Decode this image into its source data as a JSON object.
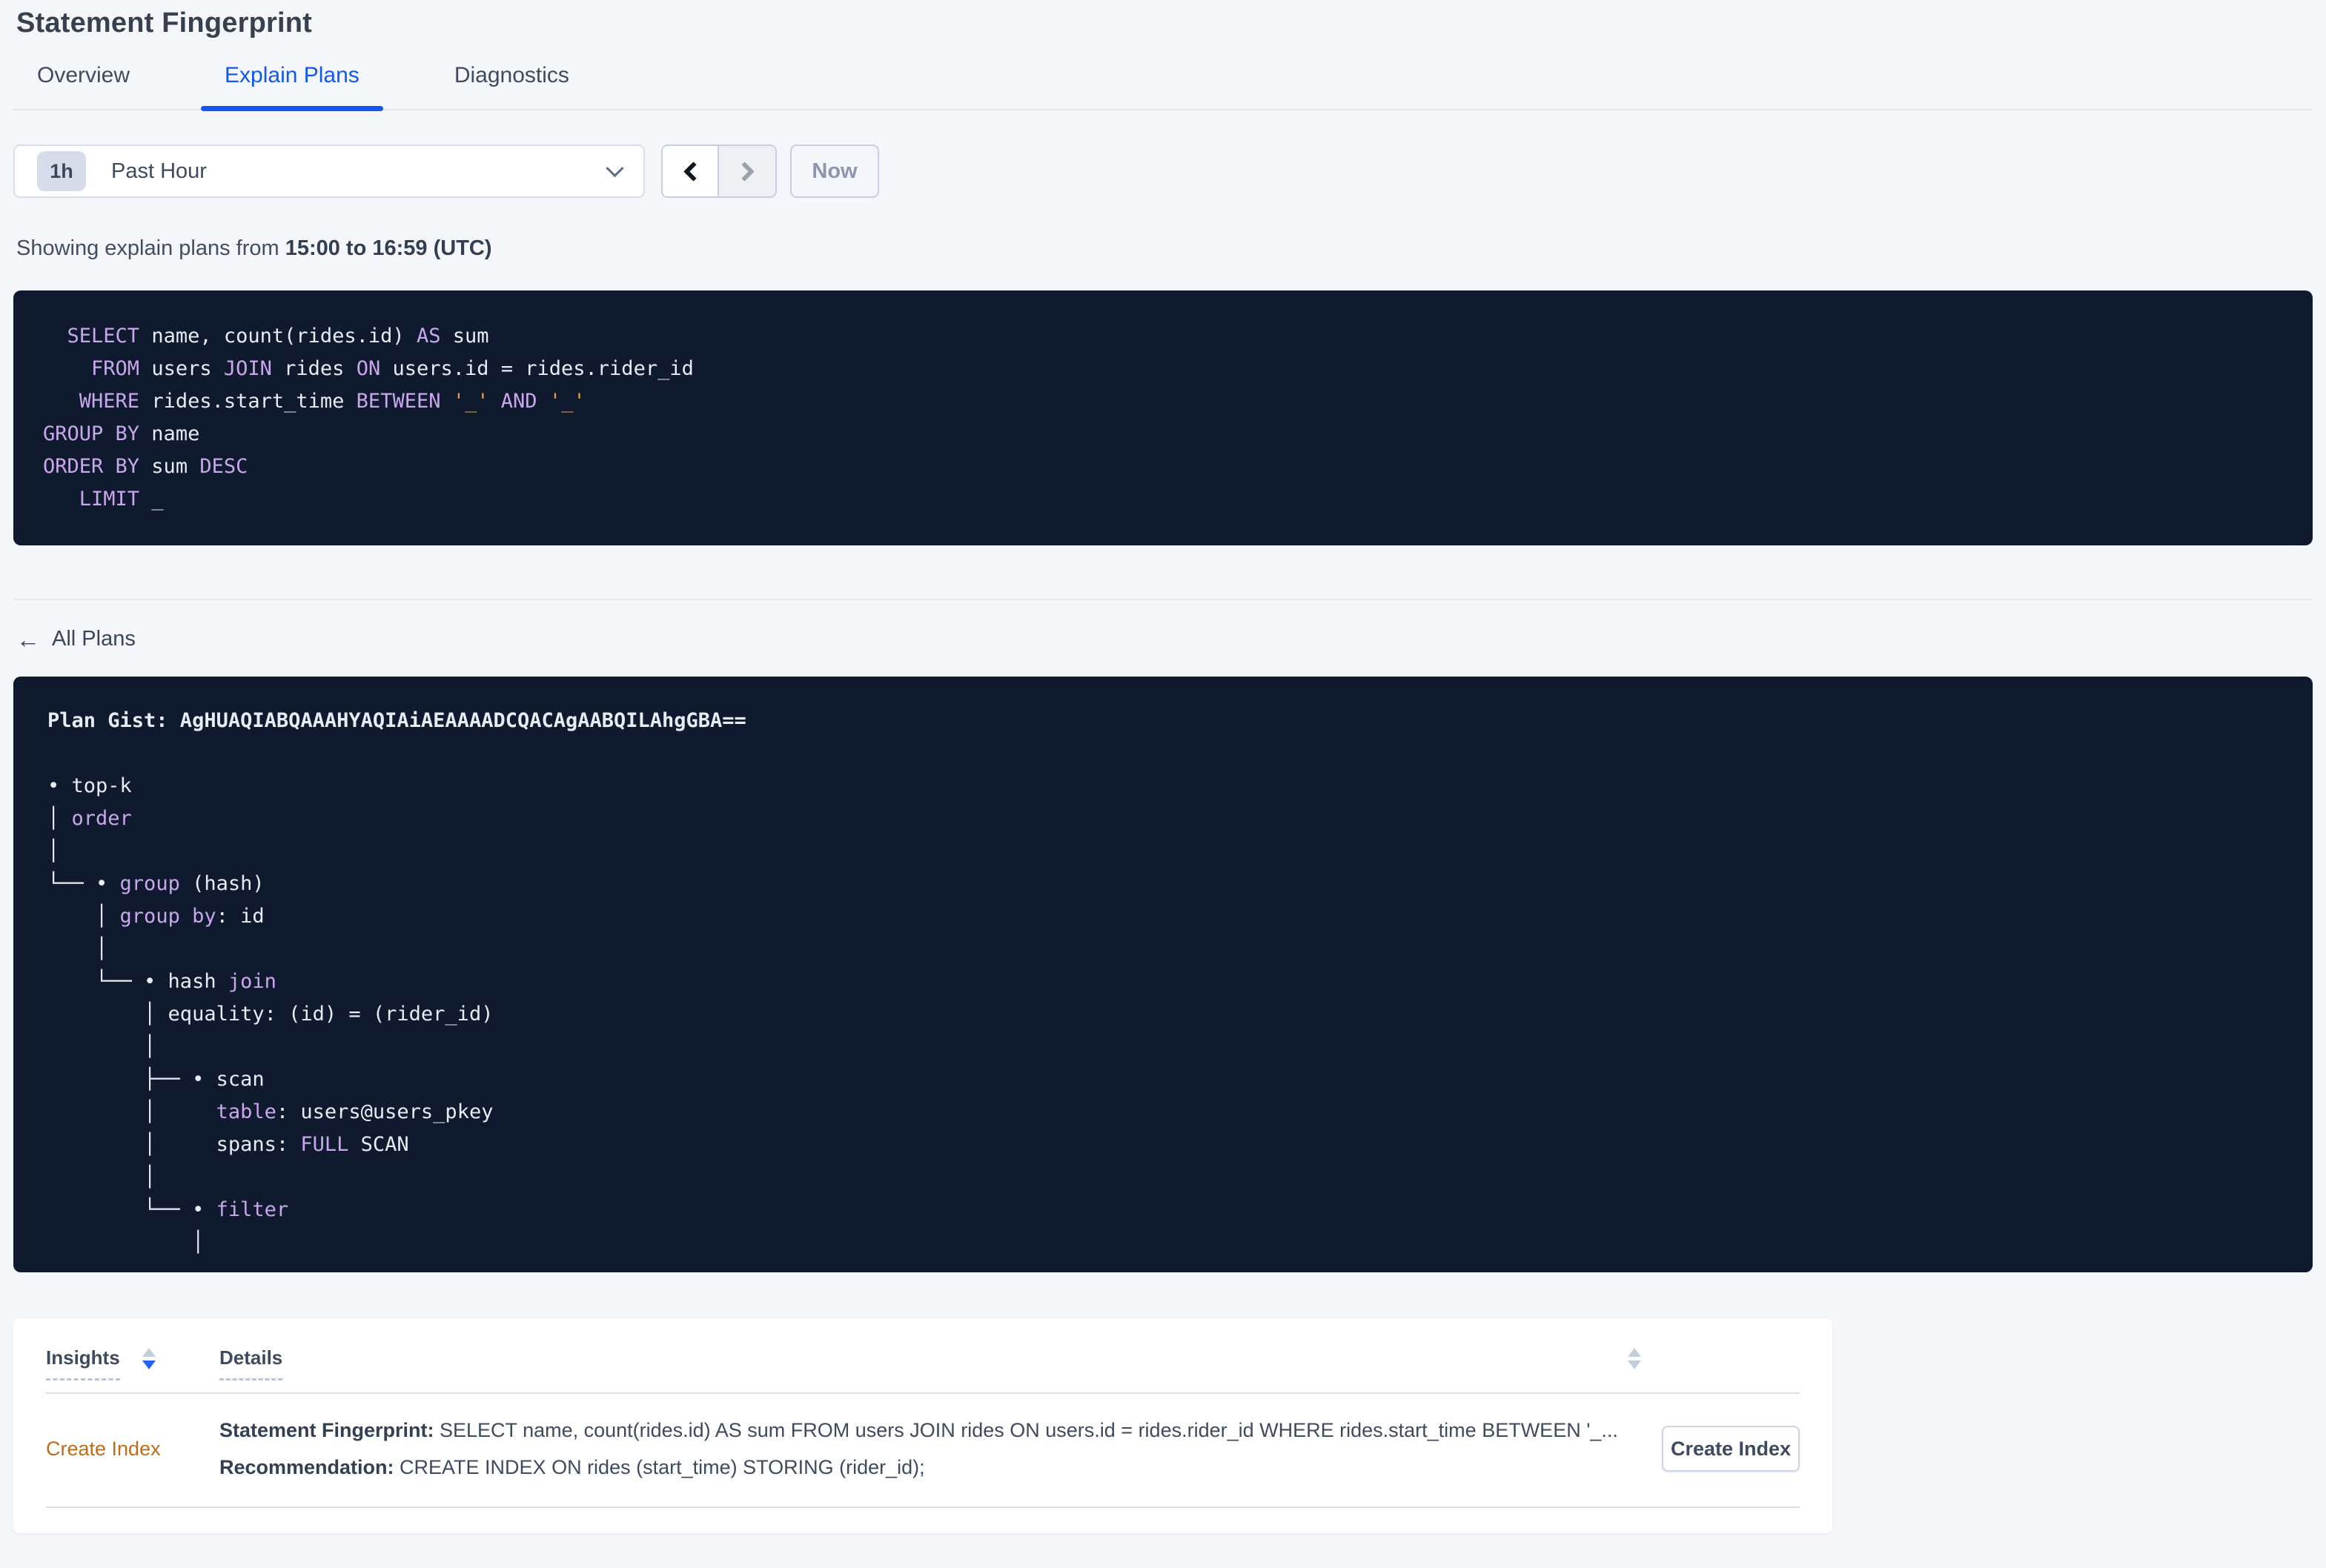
{
  "page": {
    "title": "Statement Fingerprint"
  },
  "tabs": [
    {
      "label": "Overview"
    },
    {
      "label": "Explain Plans"
    },
    {
      "label": "Diagnostics"
    }
  ],
  "time_picker": {
    "badge": "1h",
    "label": "Past Hour",
    "now_label": "Now"
  },
  "showing": {
    "prefix": "Showing explain plans from ",
    "range": "15:00 to 16:59 (UTC)"
  },
  "sql_block": {
    "lines": [
      [
        {
          "c": "p",
          "t": "  "
        },
        {
          "c": "k",
          "t": "SELECT"
        },
        {
          "c": "p",
          "t": " name, count(rides.id) "
        },
        {
          "c": "k",
          "t": "AS"
        },
        {
          "c": "p",
          "t": " sum"
        }
      ],
      [
        {
          "c": "p",
          "t": "    "
        },
        {
          "c": "k",
          "t": "FROM"
        },
        {
          "c": "p",
          "t": " users "
        },
        {
          "c": "k",
          "t": "JOIN"
        },
        {
          "c": "p",
          "t": " rides "
        },
        {
          "c": "k",
          "t": "ON"
        },
        {
          "c": "p",
          "t": " users.id = rides.rider_id"
        }
      ],
      [
        {
          "c": "p",
          "t": "   "
        },
        {
          "c": "k",
          "t": "WHERE"
        },
        {
          "c": "p",
          "t": " rides.start_time "
        },
        {
          "c": "k",
          "t": "BETWEEN"
        },
        {
          "c": "p",
          "t": " "
        },
        {
          "c": "l",
          "t": "'_'"
        },
        {
          "c": "p",
          "t": " "
        },
        {
          "c": "k",
          "t": "AND"
        },
        {
          "c": "p",
          "t": " "
        },
        {
          "c": "l",
          "t": "'_'"
        }
      ],
      [
        {
          "c": "k",
          "t": "GROUP BY"
        },
        {
          "c": "p",
          "t": " name"
        }
      ],
      [
        {
          "c": "k",
          "t": "ORDER BY"
        },
        {
          "c": "p",
          "t": " sum "
        },
        {
          "c": "k",
          "t": "DESC"
        }
      ],
      [
        {
          "c": "p",
          "t": "   "
        },
        {
          "c": "k",
          "t": "LIMIT"
        },
        {
          "c": "p",
          "t": " _"
        }
      ]
    ]
  },
  "back_link": {
    "label": "All Plans"
  },
  "gist_block": {
    "header": "Plan Gist: AgHUAQIABQAAAHYAQIAiAEAAAADCQACAgAABQILAhgGBA==",
    "lines": [
      [
        {
          "c": "p",
          "t": "• top-k"
        }
      ],
      [
        {
          "c": "p",
          "t": "│ "
        },
        {
          "c": "k",
          "t": "order"
        }
      ],
      [
        {
          "c": "p",
          "t": "│"
        }
      ],
      [
        {
          "c": "p",
          "t": "└── • "
        },
        {
          "c": "k",
          "t": "group"
        },
        {
          "c": "p",
          "t": " (hash)"
        }
      ],
      [
        {
          "c": "p",
          "t": "    │ "
        },
        {
          "c": "k",
          "t": "group by"
        },
        {
          "c": "p",
          "t": ": id"
        }
      ],
      [
        {
          "c": "p",
          "t": "    │"
        }
      ],
      [
        {
          "c": "p",
          "t": "    └── • hash "
        },
        {
          "c": "k",
          "t": "join"
        }
      ],
      [
        {
          "c": "p",
          "t": "        │ equality: (id) = (rider_id)"
        }
      ],
      [
        {
          "c": "p",
          "t": "        │"
        }
      ],
      [
        {
          "c": "p",
          "t": "        ├── • scan"
        }
      ],
      [
        {
          "c": "p",
          "t": "        │     "
        },
        {
          "c": "k",
          "t": "table"
        },
        {
          "c": "p",
          "t": ": users@users_pkey"
        }
      ],
      [
        {
          "c": "p",
          "t": "        │     spans: "
        },
        {
          "c": "k",
          "t": "FULL"
        },
        {
          "c": "p",
          "t": " SCAN"
        }
      ],
      [
        {
          "c": "p",
          "t": "        │"
        }
      ],
      [
        {
          "c": "p",
          "t": "        └── • "
        },
        {
          "c": "k",
          "t": "filter"
        }
      ],
      [
        {
          "c": "p",
          "t": "            │"
        }
      ]
    ]
  },
  "insights_table": {
    "columns": [
      {
        "label": "Insights"
      },
      {
        "label": "Details"
      }
    ],
    "rows": [
      {
        "insight": "Create Index",
        "fingerprint_label": "Statement Fingerprint:",
        "fingerprint_text": " SELECT name, count(rides.id) AS sum FROM users JOIN rides ON users.id = rides.rider_id WHERE rides.start_time BETWEEN '_...",
        "recommendation_label": "Recommendation:",
        "recommendation_text": " CREATE INDEX ON rides (start_time) STORING (rider_id);",
        "action_label": "Create Index"
      }
    ]
  },
  "colors": {
    "accent_blue": "#1158f1",
    "code_background": "#0f1a2e",
    "code_keyword": "#c8a7ec",
    "code_literal": "#eb9e41",
    "insight_link_orange": "#bf6c16"
  }
}
